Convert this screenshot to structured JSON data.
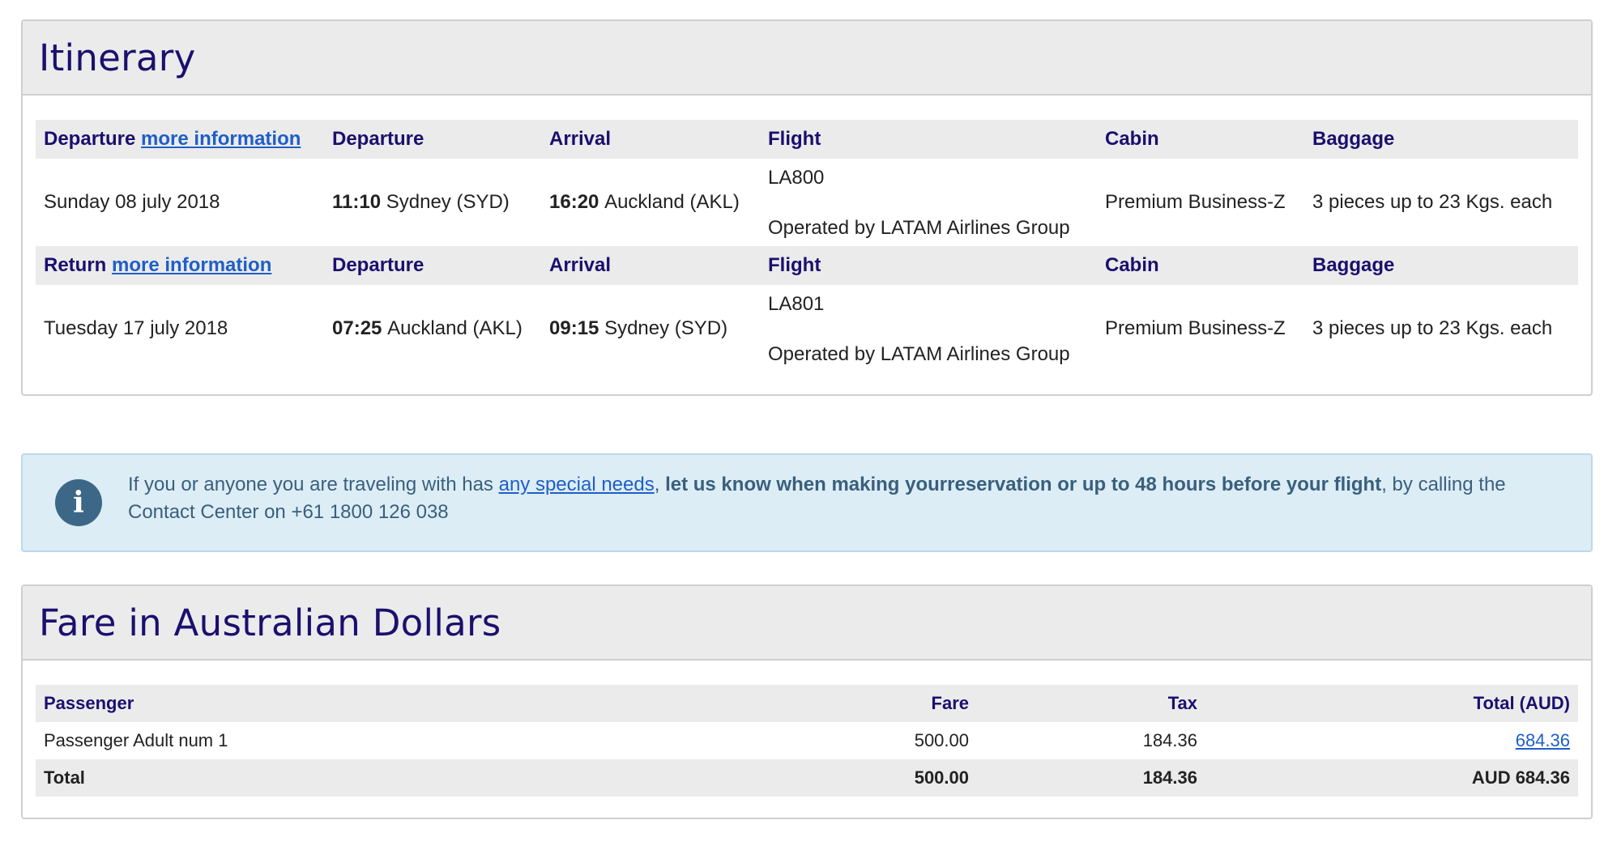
{
  "itinerary": {
    "title": "Itinerary",
    "legs": [
      {
        "type_label": "Departure",
        "more_info": "more information",
        "headers": {
          "departure": "Departure",
          "arrival": "Arrival",
          "flight": "Flight",
          "cabin": "Cabin",
          "baggage": "Baggage"
        },
        "date": "Sunday 08 july 2018",
        "dep_time": "11:10",
        "dep_place": "Sydney (SYD)",
        "arr_time": "16:20",
        "arr_place": "Auckland (AKL)",
        "flight_no": "LA800",
        "operated_by": "Operated by LATAM Airlines Group",
        "cabin": "Premium Business-Z",
        "baggage": "3 pieces up to 23 Kgs. each"
      },
      {
        "type_label": "Return",
        "more_info": "more information",
        "headers": {
          "departure": "Departure",
          "arrival": "Arrival",
          "flight": "Flight",
          "cabin": "Cabin",
          "baggage": "Baggage"
        },
        "date": "Tuesday 17 july 2018",
        "dep_time": "07:25",
        "dep_place": "Auckland (AKL)",
        "arr_time": "09:15",
        "arr_place": "Sydney (SYD)",
        "flight_no": "LA801",
        "operated_by": "Operated by LATAM Airlines Group",
        "cabin": "Premium Business-Z",
        "baggage": "3 pieces up to 23 Kgs. each"
      }
    ]
  },
  "notice": {
    "icon": "info-icon",
    "text_before": "If you or anyone you are traveling with has ",
    "link": "any special needs",
    "comma": ", ",
    "bold": "let us know when making yourreservation or up to 48 hours before your flight",
    "text_after": ", by calling the Contact Center on +61 1800 126 038"
  },
  "fare": {
    "title": "Fare in Australian Dollars",
    "headers": {
      "passenger": "Passenger",
      "fare": "Fare",
      "tax": "Tax",
      "total": "Total (AUD)"
    },
    "rows": [
      {
        "passenger": "Passenger Adult num 1",
        "fare": "500.00",
        "tax": "184.36",
        "total": "684.36"
      }
    ],
    "total_row": {
      "label": "Total",
      "fare": "500.00",
      "tax": "184.36",
      "total": "AUD 684.36"
    }
  },
  "colors": {
    "heading": "#1b0f6e",
    "link": "#1f5ec8",
    "info_bg": "#dcedf6",
    "info_icon": "#3d6787"
  }
}
